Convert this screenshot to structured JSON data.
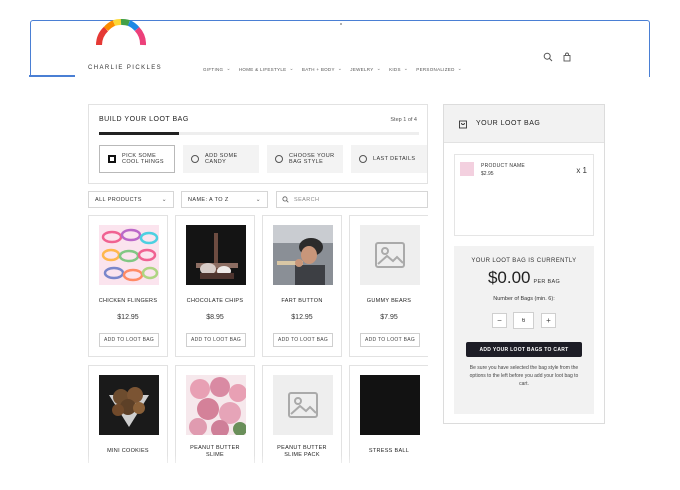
{
  "brand": {
    "logo_text": "CHARLIE PICKLES"
  },
  "nav": {
    "items": [
      {
        "label": "GIFTING"
      },
      {
        "label": "HOME & LIFESTYLE"
      },
      {
        "label": "BATH + BODY"
      },
      {
        "label": "JEWELRY"
      },
      {
        "label": "KIDS"
      },
      {
        "label": "PERSONALIZED"
      }
    ],
    "chevron": "⌄"
  },
  "builder": {
    "title": "BUILD YOUR LOOT BAG",
    "step_text": "Step 1 of 4",
    "progress": 0.25,
    "steps": [
      {
        "line1": "PICK SOME",
        "line2": "COOL THINGS",
        "active": true
      },
      {
        "line1": "ADD SOME",
        "line2": "CANDY",
        "active": false
      },
      {
        "line1": "CHOOSE YOUR",
        "line2": "BAG STYLE",
        "active": false
      },
      {
        "line1": "LAST DETAILS",
        "line2": "",
        "active": false
      }
    ]
  },
  "filters": {
    "category_value": "ALL PRODUCTS",
    "sort_value": "NAME: A TO Z",
    "search_placeholder": "SEARCH"
  },
  "products": [
    {
      "name": "CHICKEN FLINGERS",
      "price": "$12.95",
      "button": "ADD TO LOOT BAG",
      "image": "bracelets"
    },
    {
      "name": "CHOCOLATE CHIPS",
      "price": "$8.95",
      "button": "ADD TO LOOT BAG",
      "image": "chocolate"
    },
    {
      "name": "FART BUTTON",
      "price": "$12.95",
      "button": "ADD TO LOOT BAG",
      "image": "person"
    },
    {
      "name": "GUMMY BEARS",
      "price": "$7.95",
      "button": "ADD TO LOOT BAG",
      "image": "placeholder"
    },
    {
      "name": "MINI COOKIES",
      "image": "cookies"
    },
    {
      "name": "PEANUT BUTTER",
      "name2": "SLIME",
      "image": "flowers"
    },
    {
      "name": "PEANUT BUTTER",
      "name2": "SLIME PACK",
      "image": "placeholder"
    },
    {
      "name": "STRESS BALL",
      "image": "dark"
    }
  ],
  "loot_bag": {
    "title": "YOUR LOOT BAG",
    "item": {
      "name": "PRODUCT NAME",
      "price": "$2.95",
      "qty": "x 1"
    },
    "currently_label": "YOUR LOOT BAG IS CURRENTLY",
    "amount": "$0.00",
    "per_bag": "PER BAG",
    "bags_label": "Number of Bags (min. 6):",
    "quantity": "6",
    "minus": "−",
    "plus": "+",
    "cart_button": "ADD YOUR LOOT BAGS TO CART",
    "help_text": "Be sure you have selected the bag style from the options to the left before you add your loot bag to cart."
  },
  "colors": {
    "accent_frame": "#4a7fd4",
    "cart_button": "#1d1d26",
    "panel_bg": "#f2f2f2"
  }
}
